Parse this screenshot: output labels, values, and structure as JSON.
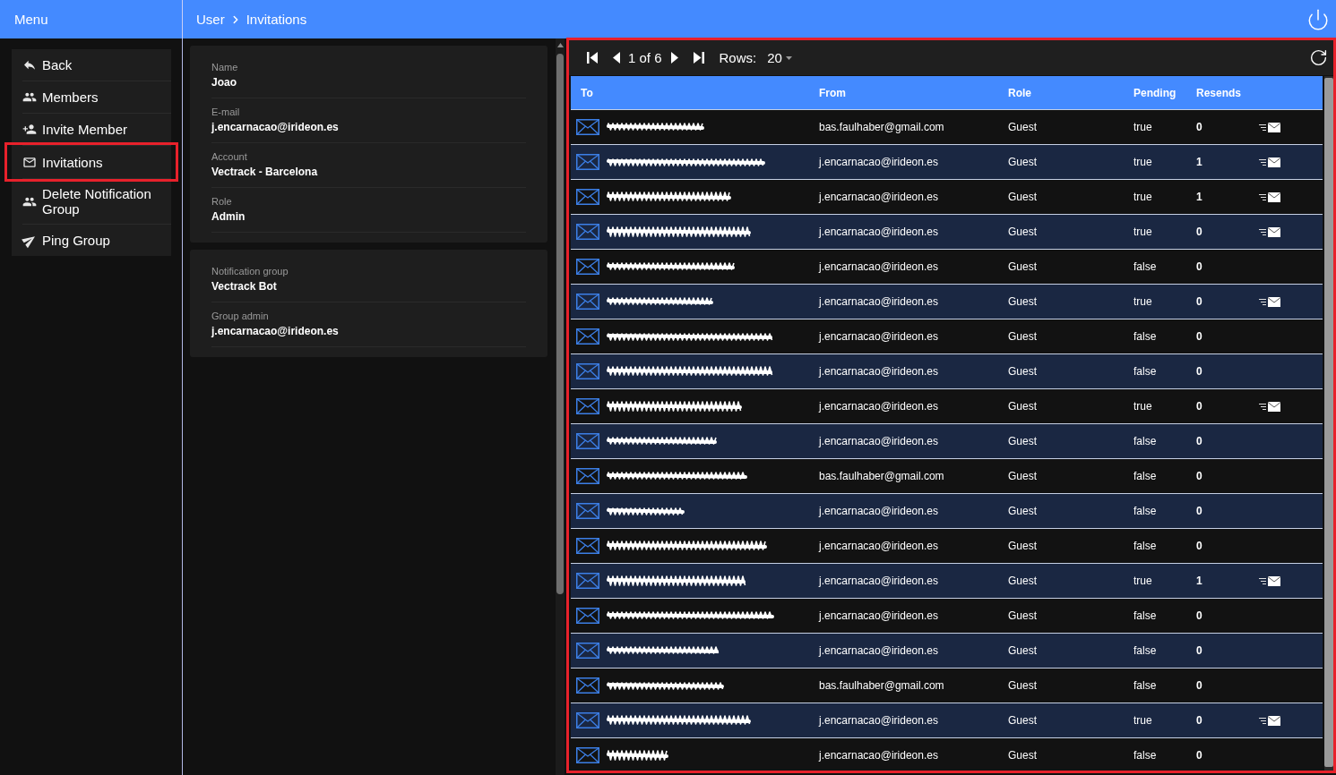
{
  "topbar": {
    "menu_title": "Menu",
    "breadcrumb": [
      {
        "label": "User"
      },
      {
        "label": "Invitations"
      }
    ]
  },
  "sidebar": {
    "items": [
      {
        "label": "Back",
        "kind": "back",
        "highlighted": false
      },
      {
        "label": "Members",
        "kind": "members",
        "highlighted": false
      },
      {
        "label": "Invite Member",
        "kind": "invite",
        "highlighted": false
      },
      {
        "label": "Invitations",
        "kind": "invitations",
        "highlighted": true
      },
      {
        "label": "Delete Notification Group",
        "kind": "delete-group",
        "highlighted": false
      },
      {
        "label": "Ping Group",
        "kind": "ping",
        "highlighted": false
      }
    ]
  },
  "details": {
    "cards": [
      {
        "fields": [
          {
            "label": "Name",
            "value": "Joao"
          },
          {
            "label": "E-mail",
            "value": "j.encarnacao@irideon.es"
          },
          {
            "label": "Account",
            "value": "Vectrack - Barcelona"
          },
          {
            "label": "Role",
            "value": "Admin"
          }
        ]
      },
      {
        "fields": [
          {
            "label": "Notification group",
            "value": "Vectrack Bot"
          },
          {
            "label": "Group admin",
            "value": "j.encarnacao@irideon.es"
          }
        ]
      }
    ]
  },
  "invitations": {
    "highlighted": true,
    "pager": {
      "page_text": "1 of 6",
      "rows_label": "Rows:",
      "rows_value": "20"
    },
    "columns": [
      "To",
      "From",
      "Role",
      "Pending",
      "Resends"
    ],
    "rows": [
      {
        "from": "bas.faulhaber@gmail.com",
        "role": "Guest",
        "pending": "true",
        "resends": "0",
        "resend_available": true
      },
      {
        "from": "j.encarnacao@irideon.es",
        "role": "Guest",
        "pending": "true",
        "resends": "1",
        "resend_available": true
      },
      {
        "from": "j.encarnacao@irideon.es",
        "role": "Guest",
        "pending": "true",
        "resends": "1",
        "resend_available": true
      },
      {
        "from": "j.encarnacao@irideon.es",
        "role": "Guest",
        "pending": "true",
        "resends": "0",
        "resend_available": true
      },
      {
        "from": "j.encarnacao@irideon.es",
        "role": "Guest",
        "pending": "false",
        "resends": "0",
        "resend_available": false
      },
      {
        "from": "j.encarnacao@irideon.es",
        "role": "Guest",
        "pending": "true",
        "resends": "0",
        "resend_available": true
      },
      {
        "from": "j.encarnacao@irideon.es",
        "role": "Guest",
        "pending": "false",
        "resends": "0",
        "resend_available": false
      },
      {
        "from": "j.encarnacao@irideon.es",
        "role": "Guest",
        "pending": "false",
        "resends": "0",
        "resend_available": false
      },
      {
        "from": "j.encarnacao@irideon.es",
        "role": "Guest",
        "pending": "true",
        "resends": "0",
        "resend_available": true
      },
      {
        "from": "j.encarnacao@irideon.es",
        "role": "Guest",
        "pending": "false",
        "resends": "0",
        "resend_available": false
      },
      {
        "from": "bas.faulhaber@gmail.com",
        "role": "Guest",
        "pending": "false",
        "resends": "0",
        "resend_available": false
      },
      {
        "from": "j.encarnacao@irideon.es",
        "role": "Guest",
        "pending": "false",
        "resends": "0",
        "resend_available": false
      },
      {
        "from": "j.encarnacao@irideon.es",
        "role": "Guest",
        "pending": "false",
        "resends": "0",
        "resend_available": false
      },
      {
        "from": "j.encarnacao@irideon.es",
        "role": "Guest",
        "pending": "true",
        "resends": "1",
        "resend_available": true
      },
      {
        "from": "j.encarnacao@irideon.es",
        "role": "Guest",
        "pending": "false",
        "resends": "0",
        "resend_available": false
      },
      {
        "from": "j.encarnacao@irideon.es",
        "role": "Guest",
        "pending": "false",
        "resends": "0",
        "resend_available": false
      },
      {
        "from": "bas.faulhaber@gmail.com",
        "role": "Guest",
        "pending": "false",
        "resends": "0",
        "resend_available": false
      },
      {
        "from": "j.encarnacao@irideon.es",
        "role": "Guest",
        "pending": "true",
        "resends": "0",
        "resend_available": true
      },
      {
        "from": "j.encarnacao@irideon.es",
        "role": "Guest",
        "pending": "false",
        "resends": "0",
        "resend_available": false
      }
    ]
  }
}
